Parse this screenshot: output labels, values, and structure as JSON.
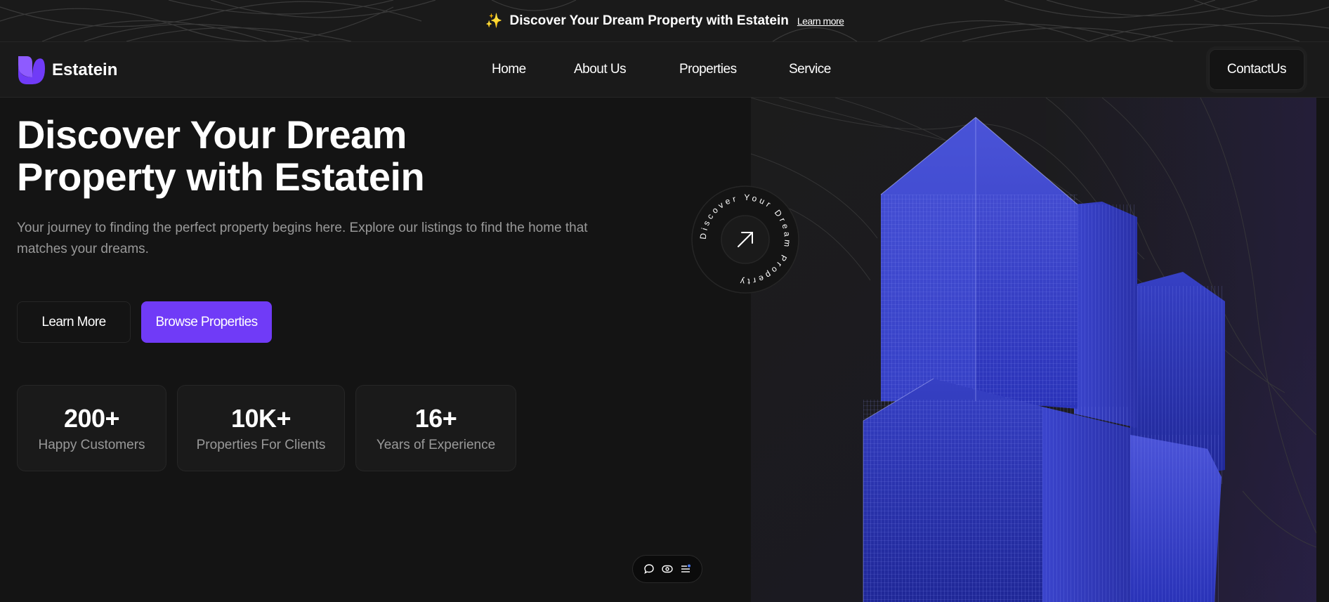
{
  "banner": {
    "sparkle_icon": "sparkles-icon",
    "text": "Discover Your Dream Property with Estatein",
    "link_label": "Learn more"
  },
  "navbar": {
    "brand": "Estatein",
    "items": [
      {
        "label": "Home"
      },
      {
        "label": "About Us"
      },
      {
        "label": "Properties"
      },
      {
        "label": "Service"
      }
    ],
    "contact_label": "ContactUs"
  },
  "hero": {
    "title_line1": "Discover Your Dream",
    "title_line2": "Property with Estatein",
    "subtitle": "Your journey to finding the perfect property begins here. Explore our listings to find the home that matches your dreams.",
    "learn_more_label": "Learn More",
    "browse_label": "Browse Properties",
    "badge_text": "Discover Your Dream Property",
    "badge_icon": "arrow-up-right-icon"
  },
  "stats": [
    {
      "value": "200+",
      "label": "Happy Customers"
    },
    {
      "value": "10K+",
      "label": "Properties For Clients"
    },
    {
      "value": "16+",
      "label": "Years of Experience"
    }
  ],
  "toolbar": {
    "icons": [
      "comment-icon",
      "eye-icon",
      "menu-icon"
    ]
  },
  "colors": {
    "accent": "#703bf7",
    "background": "#141414",
    "surface": "#1a1a1a",
    "border": "#262626",
    "muted_text": "#999999"
  }
}
